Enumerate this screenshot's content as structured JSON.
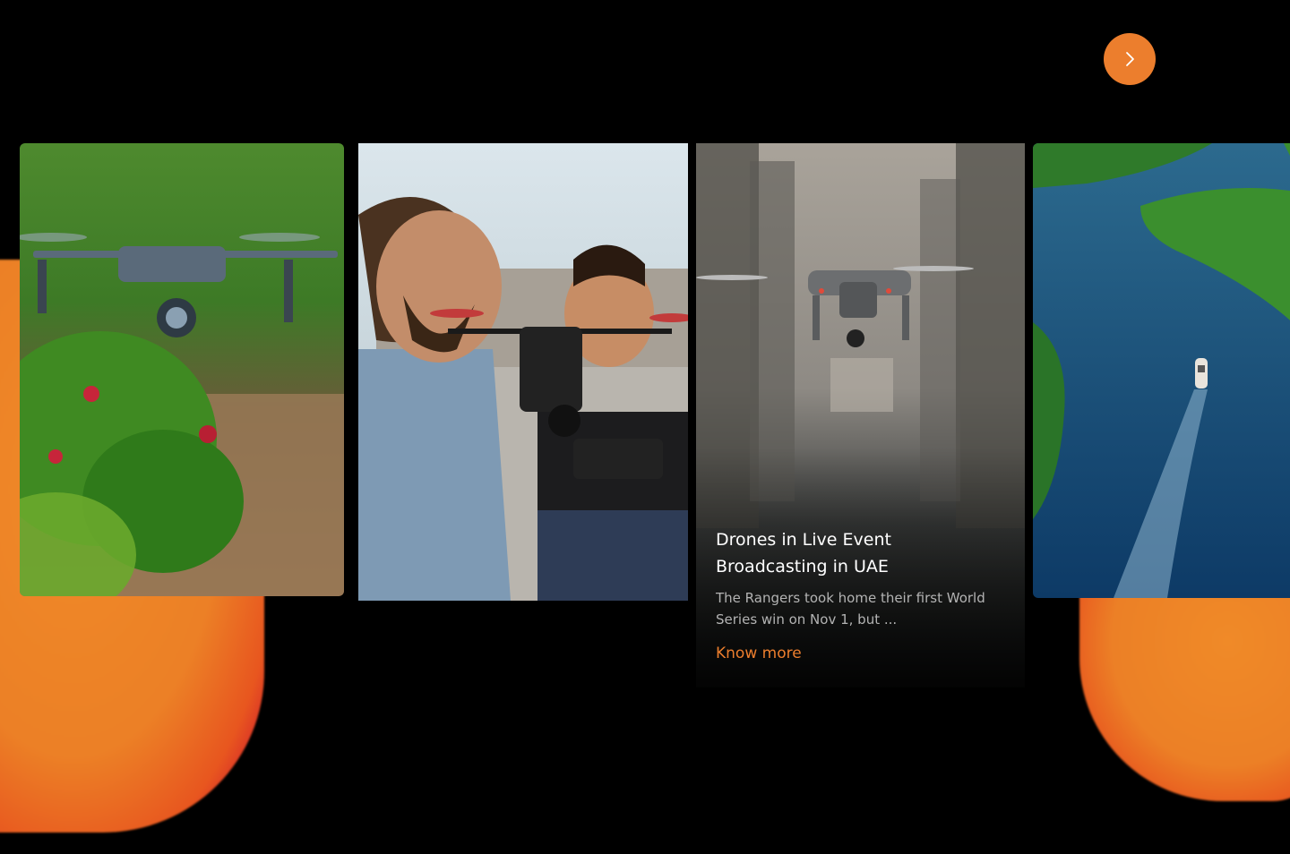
{
  "carousel": {
    "next_icon": "chevron-right-icon",
    "accent_color": "#ec7e2d",
    "cards": [
      {
        "image": "drone-over-strawberry-field"
      },
      {
        "image": "two-men-with-drone"
      },
      {
        "image": "drone-over-city-crowd",
        "title": "Drones in Live Event Broadcasting in UAE",
        "description": "The Rangers took home their first World Series win on Nov 1, but ...",
        "link_label": "Know more"
      },
      {
        "image": "aerial-river-with-boat"
      }
    ]
  }
}
